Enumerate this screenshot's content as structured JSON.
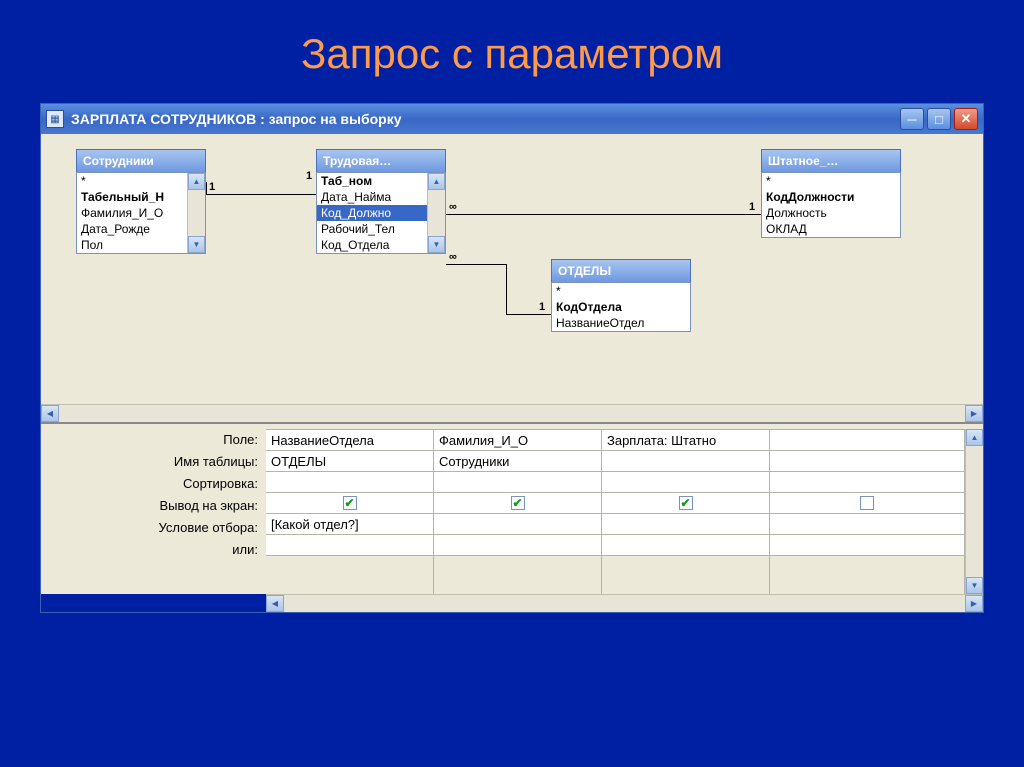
{
  "slide": {
    "title": "Запрос с параметром"
  },
  "window": {
    "title": "ЗАРПЛАТА СОТРУДНИКОВ : запрос на выборку"
  },
  "tables": {
    "employees": {
      "title": "Сотрудники",
      "fields": [
        "*",
        "Табельный_Н",
        "Фамилия_И_О",
        "Дата_Рожде",
        "Пол"
      ]
    },
    "labor": {
      "title": "Трудовая…",
      "fields": [
        "Таб_ном",
        "Дата_Найма",
        "Код_Должно",
        "Рабочий_Тел",
        "Код_Отдела"
      ]
    },
    "departments": {
      "title": "ОТДЕЛЫ",
      "fields": [
        "*",
        "КодОтдела",
        "НазваниеОтдел"
      ]
    },
    "staff": {
      "title": "Штатное_…",
      "fields": [
        "*",
        "КодДолжности",
        "Должность",
        "ОКЛАД"
      ]
    }
  },
  "relations": {
    "r1": {
      "left": "1",
      "right": "1"
    },
    "r2": {
      "left": "∞",
      "right": "1"
    },
    "r3": {
      "left": "∞",
      "right": "1"
    }
  },
  "grid": {
    "labels": {
      "field": "Поле:",
      "table": "Имя таблицы:",
      "sort": "Сортировка:",
      "show": "Вывод на экран:",
      "criteria": "Условие отбора:",
      "or": "или:"
    },
    "cols": [
      {
        "field": "НазваниеОтдела",
        "table": "ОТДЕЛЫ",
        "sort": "",
        "show": true,
        "criteria": "[Какой отдел?]",
        "or": ""
      },
      {
        "field": "Фамилия_И_О",
        "table": "Сотрудники",
        "sort": "",
        "show": true,
        "criteria": "",
        "or": ""
      },
      {
        "field": "Зарплата: Штатно",
        "table": "",
        "sort": "",
        "show": true,
        "criteria": "",
        "or": ""
      },
      {
        "field": "",
        "table": "",
        "sort": "",
        "show": false,
        "criteria": "",
        "or": ""
      }
    ]
  }
}
